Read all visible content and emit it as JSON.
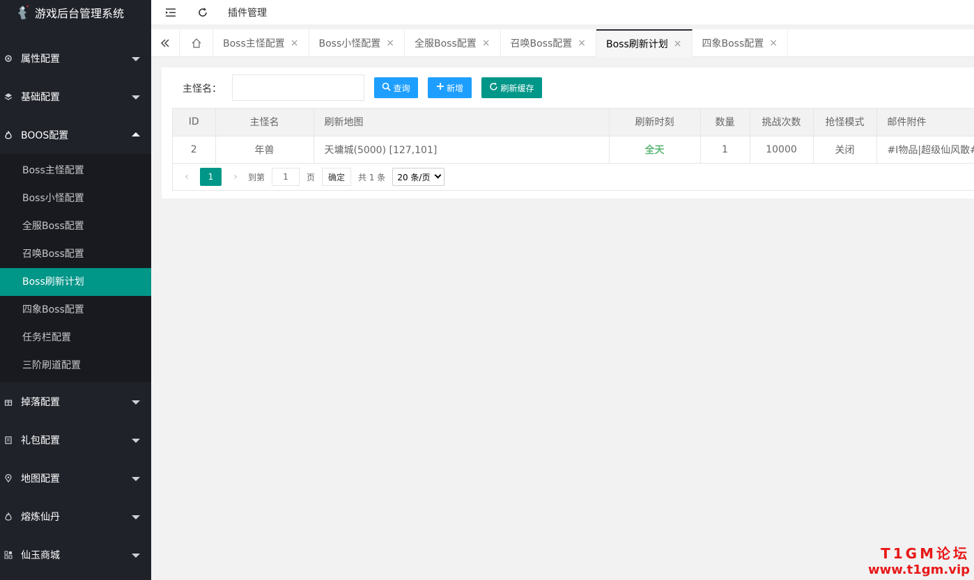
{
  "app": {
    "title": "游戏后台管理系统"
  },
  "header": {
    "title": "插件管理"
  },
  "sidebar": {
    "groups": [
      {
        "label": "属性配置",
        "icon": "gear-icon"
      },
      {
        "label": "基础配置",
        "icon": "layers-icon"
      },
      {
        "label": "BOOS配置",
        "icon": "fire-icon",
        "expanded": true,
        "items": [
          {
            "label": "Boss主怪配置"
          },
          {
            "label": "Boss小怪配置"
          },
          {
            "label": "全服Boss配置"
          },
          {
            "label": "召唤Boss配置"
          },
          {
            "label": "Boss刷新计划",
            "active": true
          },
          {
            "label": "四象Boss配置"
          },
          {
            "label": "任务栏配置"
          },
          {
            "label": "三阶刷道配置"
          }
        ]
      },
      {
        "label": "掉落配置",
        "icon": "gift-icon"
      },
      {
        "label": "礼包配置",
        "icon": "clipboard-icon"
      },
      {
        "label": "地图配置",
        "icon": "location-icon"
      },
      {
        "label": "熔炼仙丹",
        "icon": "fire-icon"
      },
      {
        "label": "仙玉商城",
        "icon": "apps-icon"
      }
    ]
  },
  "tabs": [
    {
      "label": "Boss主怪配置"
    },
    {
      "label": "Boss小怪配置"
    },
    {
      "label": "全服Boss配置"
    },
    {
      "label": "召唤Boss配置"
    },
    {
      "label": "Boss刷新计划",
      "active": true
    },
    {
      "label": "四象Boss配置"
    }
  ],
  "search": {
    "label": "主怪名：",
    "value": "",
    "query_label": "查询",
    "add_label": "新增",
    "refresh_label": "刷新缓存"
  },
  "table": {
    "columns": [
      "ID",
      "主怪名",
      "刷新地图",
      "刷新时刻",
      "数量",
      "挑战次数",
      "抢怪模式",
      "邮件附件"
    ],
    "rows": [
      [
        "2",
        "年兽",
        "天墉城(5000) [127,101]",
        "全天",
        "1",
        "10000",
        "关闭",
        "#I物品|超级仙风散#r"
      ]
    ]
  },
  "pager": {
    "current": "1",
    "goto_label": "到第",
    "goto_value": "1",
    "page_label": "页",
    "confirm_label": "确定",
    "total_label": "共 1 条",
    "page_size": "20 条/页"
  },
  "watermark": {
    "line1": "T1GM论坛",
    "line2": "www.t1gm.vip"
  },
  "colors": {
    "sidebar_bg": "#20222a",
    "accent": "#009688",
    "blue": "#1e9fff",
    "status_green": "#5fb878"
  }
}
